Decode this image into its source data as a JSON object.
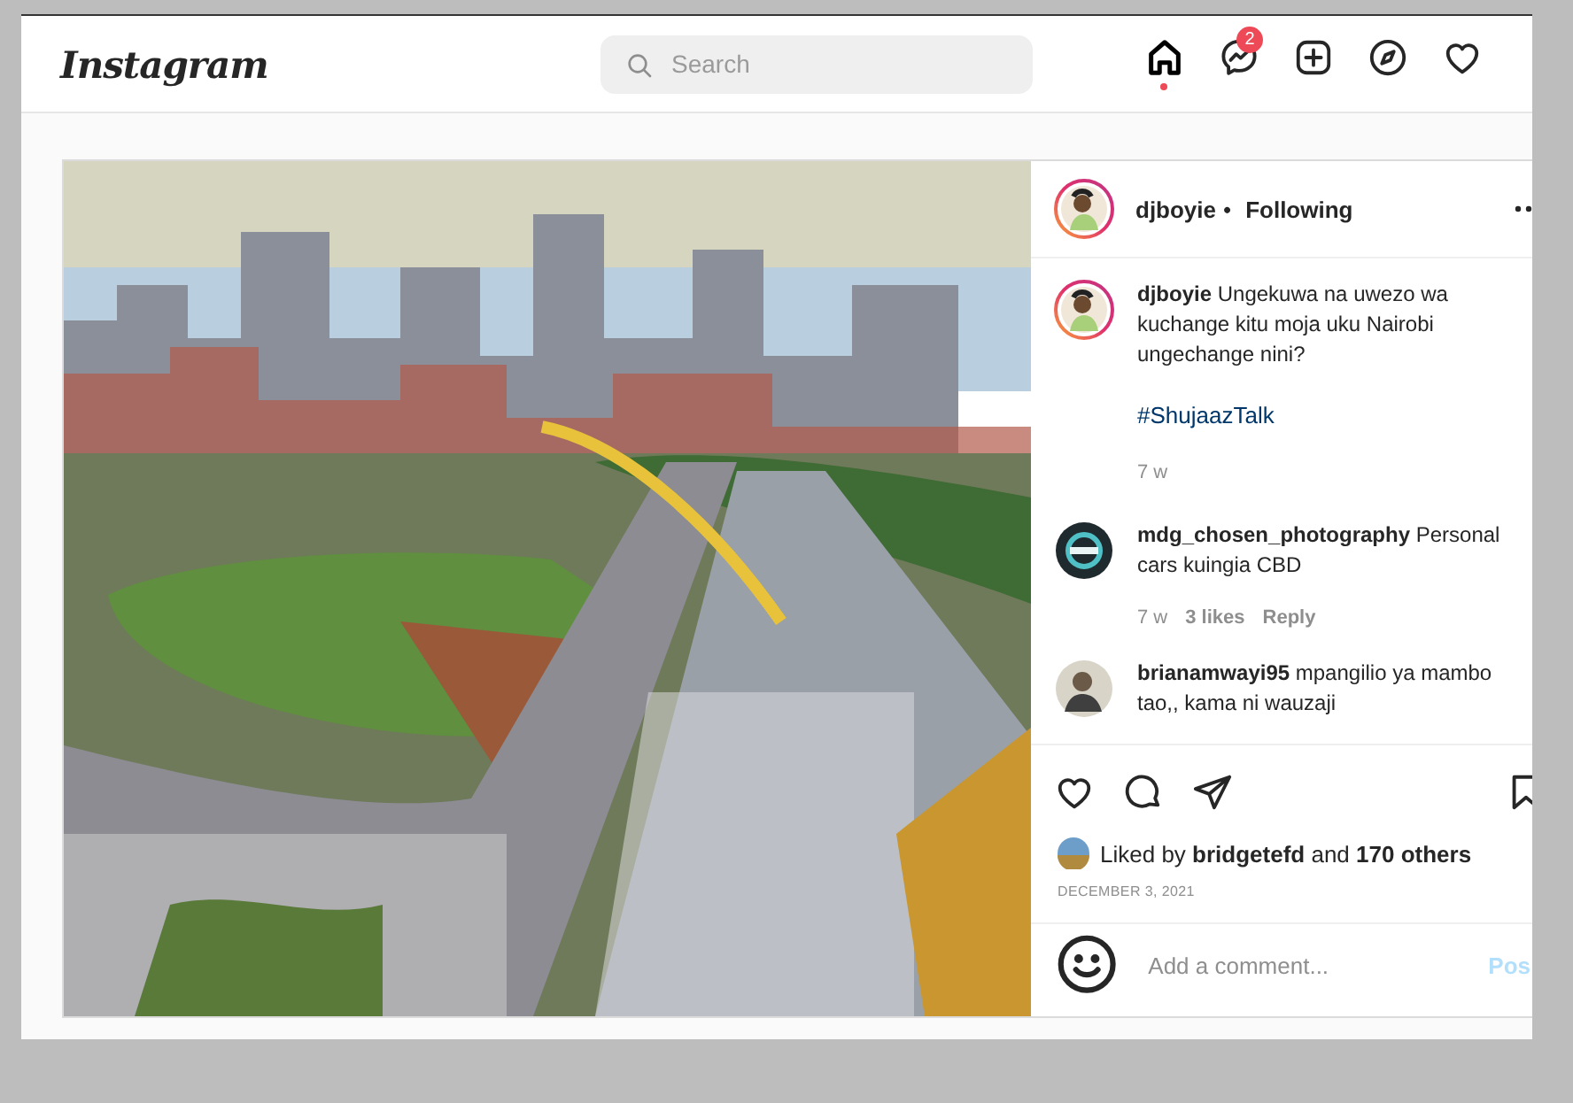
{
  "header": {
    "logo": "Instagram",
    "search": {
      "placeholder": "Search"
    },
    "nav": [
      {
        "kind": "home",
        "selected": true
      },
      {
        "kind": "messenger",
        "selected": false,
        "badge": "2"
      },
      {
        "kind": "new-post",
        "selected": false
      },
      {
        "kind": "explore",
        "selected": false
      },
      {
        "kind": "activity",
        "selected": false
      }
    ]
  },
  "post": {
    "author": {
      "username": "djboyie",
      "separator": "•",
      "relation": "Following"
    },
    "comments": [
      {
        "kind": "caption",
        "username": "djboyie",
        "text": "Ungekuwa na uwezo wa kuchange kitu moja uku Nairobi ungechange nini?",
        "hashtag": "#ShujaazTalk",
        "time": "7 w"
      },
      {
        "kind": "logo",
        "username": "mdg_chosen_photography",
        "text": "Personal cars kuingia CBD",
        "time": "7 w",
        "likes": "3 likes",
        "reply": "Reply"
      },
      {
        "username": "brianamwayi95",
        "text": "mpangilio ya mambo tao,, kama ni wauzaji"
      }
    ],
    "likes": "Liked by **bridgetefd** and **170 others**",
    "date": "DECEMBER 3, 2021",
    "add_comment": {
      "placeholder": "Add a comment...",
      "post": "Pos"
    }
  }
}
